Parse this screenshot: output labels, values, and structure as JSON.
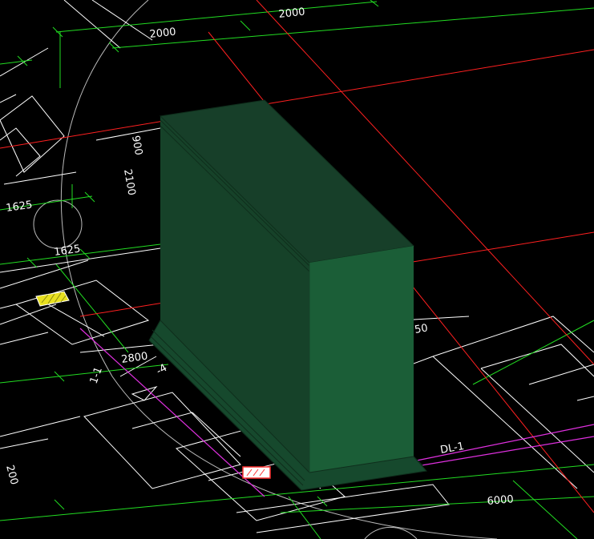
{
  "viewport": {
    "background": "#000000",
    "colors": {
      "axis": "#ff2020",
      "dimension": "#22dd22",
      "outline": "#ffffff",
      "beam": "#e030e0",
      "arc": "#bbbbbb",
      "solid_top": "#173f29",
      "solid_front": "#1b5e37",
      "solid_side": "#164229",
      "solid_edge": "#0f2e1c",
      "marker_yellow": "#e8e020",
      "marker_red": "#ff3030"
    },
    "dimensions": {
      "top_a": "2000",
      "top_b": "2000",
      "left_a": "1625",
      "left_b": "1625",
      "bottom_mid": "2800",
      "bottom_right": "6000"
    },
    "labels": {
      "beam_tag": "DL-1",
      "rotated_a": "900",
      "rotated_b": "2100",
      "rotated_c": "200",
      "stub": "-4",
      "small_50": "50",
      "side_1": "1-1"
    }
  }
}
